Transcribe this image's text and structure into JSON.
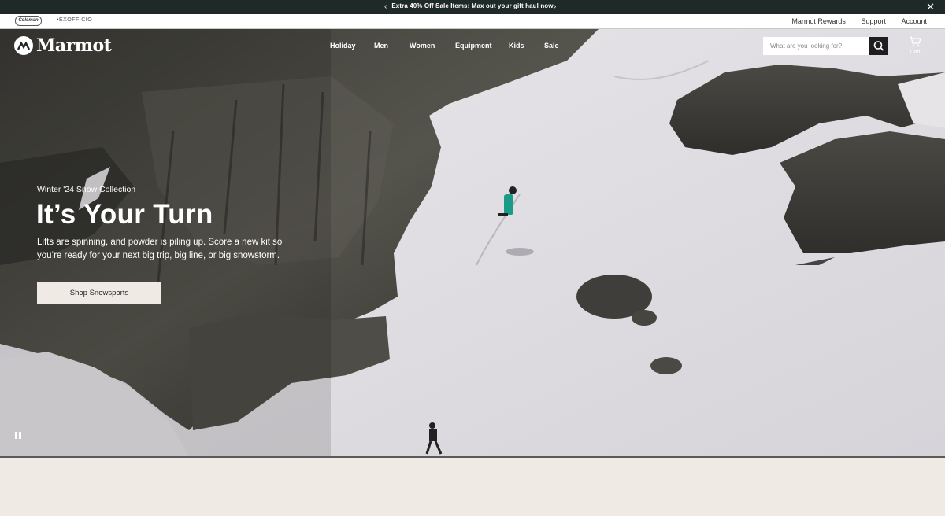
{
  "announcement": {
    "message": "Extra 40% Off Sale Items: Max out your gift haul now",
    "prev_icon": "chevron-left-icon",
    "next_icon": "chevron-right-icon",
    "close_icon": "close-icon"
  },
  "utility": {
    "brands": [
      "Coleman",
      "EXOFFICIO"
    ],
    "links": [
      "Marmot Rewards",
      "Support",
      "Account"
    ]
  },
  "header": {
    "logo_text": "Marmot",
    "nav": [
      "Holiday",
      "Men",
      "Women",
      "Equipment",
      "Kids",
      "Sale"
    ],
    "search_placeholder": "What are you looking for?",
    "search_icon": "search-icon",
    "cart_label": "Cart",
    "cart_icon": "cart-icon"
  },
  "hero": {
    "eyebrow": "Winter '24 Snow Collection",
    "headline": "It’s Your Turn",
    "subcopy": "Lifts are spinning, and powder is piling up. Score a new kit so you’re ready for your next big trip, big line, or big snowstorm.",
    "cta_label": "Shop Snowsports",
    "pause_icon": "pause-icon"
  },
  "colors": {
    "announcement_bg": "#1f2a28",
    "cta_bg": "#efebe4",
    "page_bg": "#efebe4",
    "search_button": "#1e1e1e"
  }
}
